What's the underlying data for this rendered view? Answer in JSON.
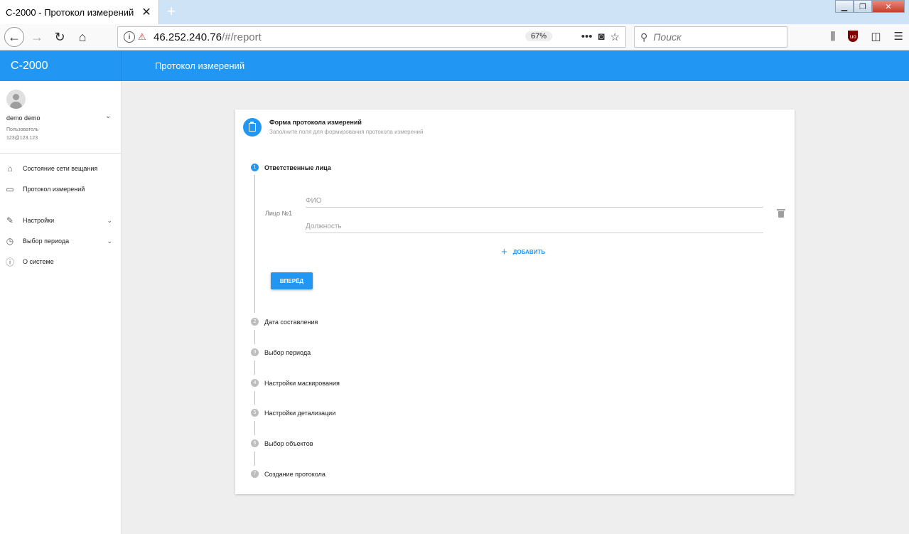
{
  "browser": {
    "tab_title": "С-2000 - Протокол измерений",
    "new_tab": "+",
    "url_host": "46.252.240.76",
    "url_path": "/#/report",
    "zoom": "67%",
    "search_placeholder": "Поиск"
  },
  "app": {
    "brand": "С-2000",
    "page_title": "Протокол измерений"
  },
  "user": {
    "name": "demo demo",
    "role": "Пользователь",
    "email": "123@123.123"
  },
  "sidebar": {
    "items": [
      {
        "label": "Состояние сети вещания"
      },
      {
        "label": "Протокол измерений"
      },
      {
        "label": "Настройки"
      },
      {
        "label": "Выбор периода"
      },
      {
        "label": "О системе"
      }
    ]
  },
  "form": {
    "title": "Форма протокола измерений",
    "subtitle": "Заполните поля для формирования протокола измерений",
    "steps": [
      {
        "num": "1",
        "label": "Ответственные лица"
      },
      {
        "num": "2",
        "label": "Дата составления"
      },
      {
        "num": "3",
        "label": "Выбор периода"
      },
      {
        "num": "4",
        "label": "Настройки маскирования"
      },
      {
        "num": "5",
        "label": "Настройки детализации"
      },
      {
        "num": "6",
        "label": "Выбор объектов"
      },
      {
        "num": "7",
        "label": "Создание протокола"
      }
    ],
    "person_label": "Лицо №1",
    "fio_placeholder": "ФИО",
    "fio_value": "",
    "position_placeholder": "Должность",
    "position_value": "",
    "add_label": "ДОБАВИТЬ",
    "next_label": "ВПЕРЁД"
  }
}
